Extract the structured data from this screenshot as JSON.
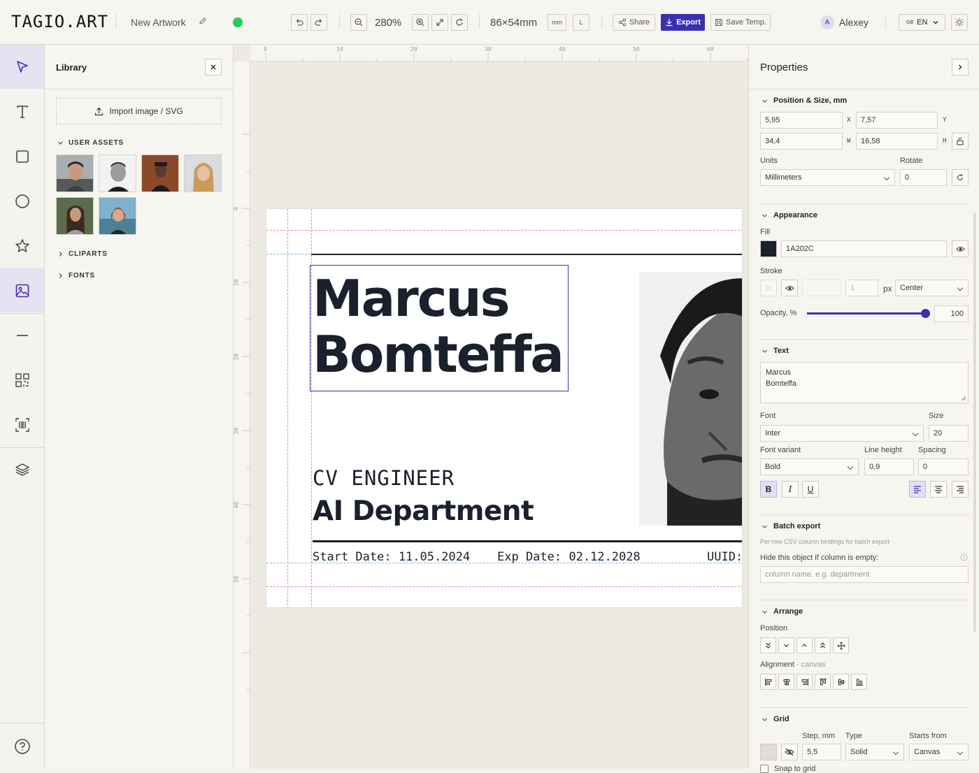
{
  "header": {
    "logo": "TAGIO.ART",
    "artwork_name": "New Artwork",
    "zoom": "280%",
    "size": "86×54mm",
    "unit_badge": "mm",
    "orientation_badge": "L",
    "share_label": "Share",
    "export_label": "Export",
    "save_template_label": "Save Temp.",
    "user_initial": "A",
    "user_name": "Alexey",
    "lang_flag": "GB",
    "lang": "EN",
    "status_color": "#22cc55"
  },
  "library": {
    "title": "Library",
    "import_label": "Import image / SVG",
    "user_assets_label": "USER ASSETS",
    "cliparts_label": "CLIPARTS",
    "fonts_label": "FONTS"
  },
  "ruler": {
    "top_ticks": [
      "0",
      "10",
      "20",
      "30",
      "40",
      "50",
      "60"
    ],
    "left_ticks": [
      "0",
      "10",
      "20",
      "30",
      "40",
      "50"
    ]
  },
  "card": {
    "name_line1": "Marcus",
    "name_line2": "Bomteffa",
    "role": "CV ENGINEER",
    "department": "AI Department",
    "start_date": "Start Date: 11.05.2024",
    "exp_date": "Exp Date: 02.12.2028",
    "uuid": "UUID:"
  },
  "properties": {
    "title": "Properties",
    "position_section": "Position & Size, mm",
    "x_value": "5,95",
    "x_label": "X",
    "y_value": "7,57",
    "y_label": "Y",
    "w_value": "34,4",
    "w_label": "W",
    "h_value": "16,58",
    "h_label": "H",
    "units_label": "Units",
    "units_value": "Millimeters",
    "rotate_label": "Rotate",
    "rotate_value": "0",
    "appearance_section": "Appearance",
    "fill_label": "Fill",
    "fill_value": "1A202C",
    "fill_color": "#1a202c",
    "stroke_label": "Stroke",
    "stroke_width": "1",
    "stroke_unit": "px",
    "stroke_align": "Center",
    "opacity_label": "Opacity, %",
    "opacity_value": "100",
    "opacity_level": 1.0,
    "text_section": "Text",
    "text_line1": "Marcus",
    "text_line2": "Bomteffa",
    "font_label": "Font",
    "font_value": "Inter",
    "size_label": "Size",
    "size_value": "20",
    "variant_label": "Font variant",
    "variant_value": "Bold",
    "lineheight_label": "Line height",
    "lineheight_value": "0,9",
    "spacing_label": "Spacing",
    "spacing_value": "0",
    "bold_label": "B",
    "italic_label": "I",
    "underline_label": "U",
    "batch_section": "Batch export",
    "batch_desc": "Per-row CSV column bindings for batch export",
    "hide_label": "Hide this object if column is empty:",
    "column_placeholder": "column name, e.g. department",
    "arrange_section": "Arrange",
    "position_label": "Position",
    "alignment_label": "Alignment",
    "alignment_sub": "· canvas",
    "grid_section": "Grid",
    "step_label": "Step, mm",
    "step_value": "5,5",
    "type_label": "Type",
    "type_value": "Solid",
    "starts_label": "Starts from",
    "starts_value": "Canvas",
    "snap_label": "Snap to grid"
  }
}
